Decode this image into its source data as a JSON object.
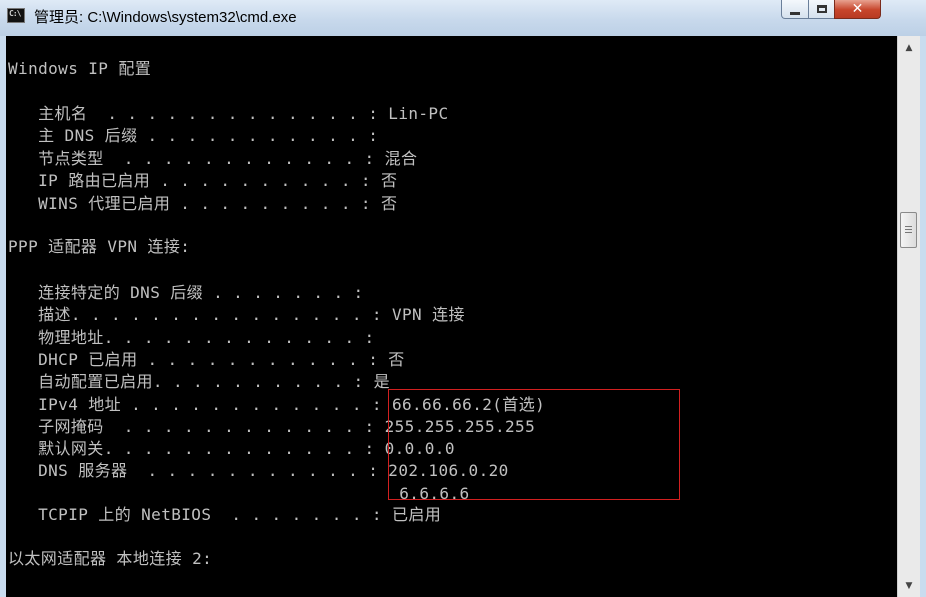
{
  "window": {
    "title": "管理员: C:\\Windows\\system32\\cmd.exe",
    "icon_label": "C:\\"
  },
  "console": {
    "lines": [
      "Windows IP 配置",
      "",
      "   主机名  . . . . . . . . . . . . . : Lin-PC",
      "   主 DNS 后缀 . . . . . . . . . . . :",
      "   节点类型  . . . . . . . . . . . . : 混合",
      "   IP 路由已启用 . . . . . . . . . . : 否",
      "   WINS 代理已启用 . . . . . . . . . : 否",
      "",
      "PPP 适配器 VPN 连接:",
      "",
      "   连接特定的 DNS 后缀 . . . . . . . :",
      "   描述. . . . . . . . . . . . . . . : VPN 连接",
      "   物理地址. . . . . . . . . . . . . :",
      "   DHCP 已启用 . . . . . . . . . . . : 否",
      "   自动配置已启用. . . . . . . . . . : 是",
      "   IPv4 地址 . . . . . . . . . . . . : 66.66.66.2(首选)",
      "   子网掩码  . . . . . . . . . . . . : 255.255.255.255",
      "   默认网关. . . . . . . . . . . . . : 0.0.0.0",
      "   DNS 服务器  . . . . . . . . . . . : 202.106.0.20",
      "                                       6.6.6.6",
      "   TCPIP 上的 NetBIOS  . . . . . . . : 已启用",
      "",
      "以太网适配器 本地连接 2:"
    ]
  },
  "colors": {
    "console_bg": "#000000",
    "console_text": "#c0c0c0",
    "highlight_border": "#d22020"
  },
  "icons": {
    "app": "cmd-icon",
    "minimize": "minimize-icon",
    "maximize": "maximize-icon",
    "close": "close-icon",
    "scroll_up": "arrow-up-icon",
    "scroll_down": "arrow-down-icon"
  }
}
